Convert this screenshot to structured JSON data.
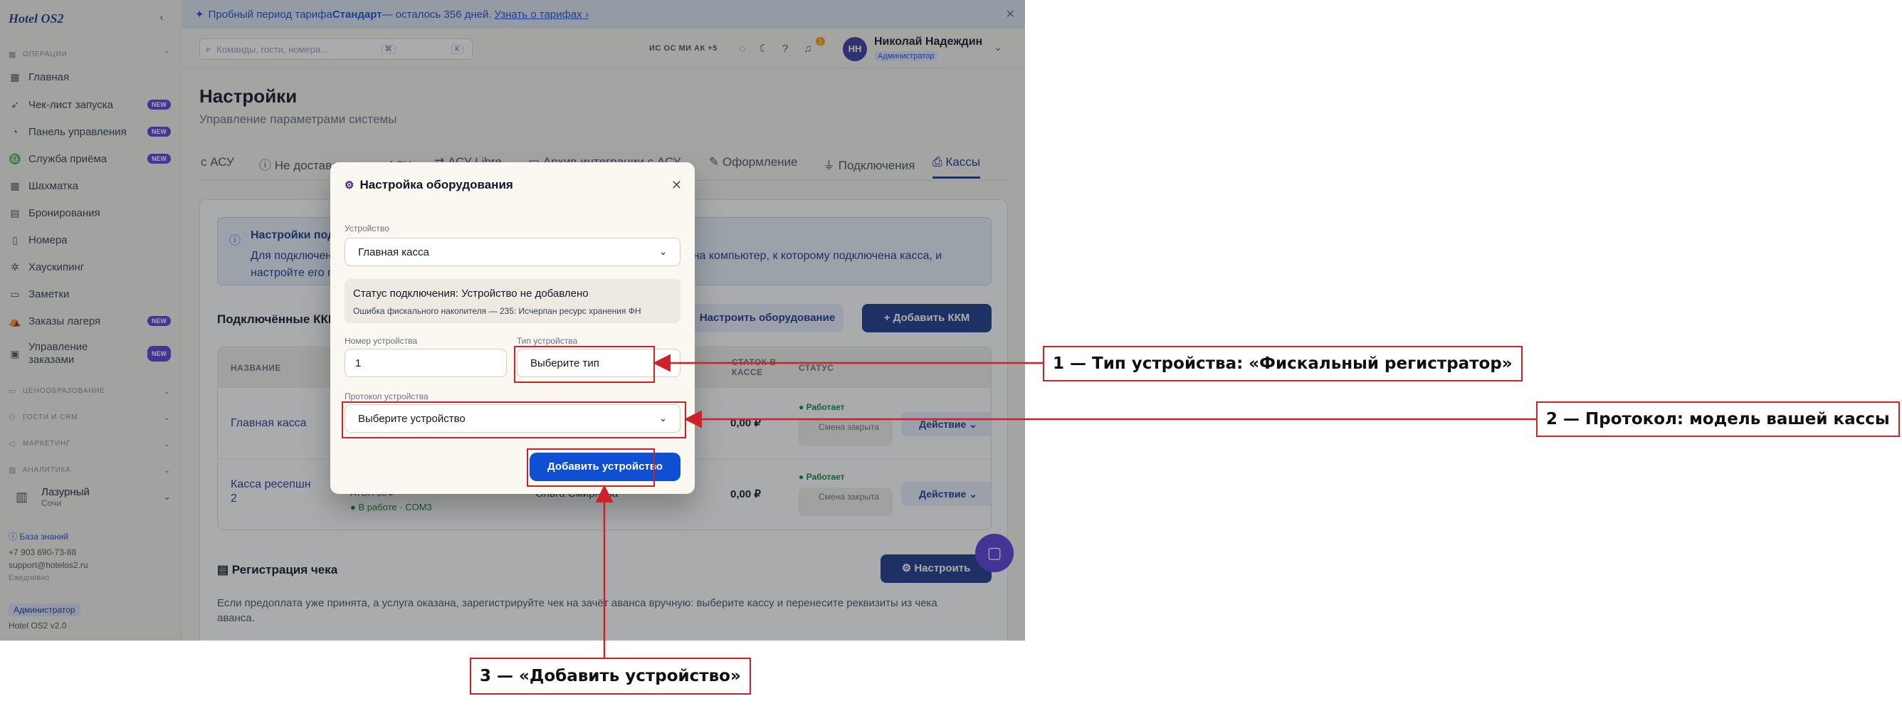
{
  "app": {
    "logo": "Hotel OS2"
  },
  "sidebar": {
    "sections": {
      "operations": "ОПЕРАЦИИ",
      "pricing": "ЦЕНООБРАЗОВАНИЕ",
      "guests": "ГОСТИ И CRM",
      "marketing": "МАРКЕТИНГ",
      "analytics": "АНАЛИТИКА"
    },
    "items": [
      {
        "label": "Главная",
        "badge": ""
      },
      {
        "label": "Чек-лист запуска",
        "badge": "NEW"
      },
      {
        "label": "Панель управления",
        "badge": "NEW"
      },
      {
        "label": "Служба приёма",
        "badge": "NEW"
      },
      {
        "label": "Шахматка",
        "badge": ""
      },
      {
        "label": "Бронирования",
        "badge": ""
      },
      {
        "label": "Номера",
        "badge": ""
      },
      {
        "label": "Хаускипинг",
        "badge": ""
      },
      {
        "label": "Заметки",
        "badge": ""
      },
      {
        "label": "Заказы лагеря",
        "badge": "NEW"
      },
      {
        "label": "Управление заказами",
        "badge": "NEW"
      }
    ],
    "hotel": {
      "name": "Лазурный",
      "city": "Сочи"
    },
    "footer": {
      "kb": "База знаний",
      "phone": "+7 903 690-73-88",
      "email": "support@hotelos2.ru",
      "hours": "Ежедневно",
      "role": "Администратор",
      "version": "Hotel OS2 v2.0"
    }
  },
  "trial_banner": {
    "prefix": "Пробный период тарифа ",
    "plan": "Стандарт",
    "middle": " — осталось 356 дней. ",
    "link": "Узнать о тарифах ›"
  },
  "topbar": {
    "search_placeholder": "Команды, гости, номера...",
    "kbd1": "⌘",
    "kbd2": "K",
    "avatars": "ИС ОС МИ АК +5",
    "notif_count": "1",
    "user_initials": "НН",
    "user_name": "Николай Надеждин",
    "user_role": "Администратор"
  },
  "page": {
    "title": "Настройки",
    "subtitle": "Управление параметрами системы"
  },
  "tabs": [
    "с АСУ",
    "Не доставленные в АСУ",
    "АСУ Libre",
    "Архив интеграции с АСУ",
    "Оформление",
    "Подключения",
    "Кассы"
  ],
  "info": {
    "title": "Настройки подключения кассы",
    "text": "Для подключения кассы выберите тип устройства и протокол. Установите драйвер на компьютер, к которому подключена касса, и настройте его параметры ниже."
  },
  "kkm": {
    "title": "Подключённые ККМ",
    "configure_btn": "Настроить оборудование",
    "add_btn": "+ Добавить ККМ",
    "headers": [
      "НАЗВАНИЕ",
      "СТАТОК В КАССЕ",
      "СТАТУС"
    ],
    "rows": [
      {
        "name": "Главная касса",
        "sum": "0,00 ₽",
        "status": "Работает",
        "shift": "Смена закрыта",
        "action": "Действие ⌄"
      },
      {
        "name": "Касса ресепшн 2",
        "device": "АТОЛ 30Ф",
        "online": "● В работе · COM3",
        "person": "Ольга Смирнова",
        "sum": "0,00 ₽",
        "status": "Работает",
        "shift": "Смена закрыта",
        "action": "Действие ⌄"
      }
    ]
  },
  "receipt": {
    "title": "Регистрация чека",
    "btn": "Настроить",
    "text": "Если предоплата уже принята, а услуга оказана, зарегистрируйте чек на зачёт аванса вручную: выберите кассу и перенесите реквизиты из чека аванса."
  },
  "modal": {
    "title": "Настройка оборудования",
    "device_label": "Устройство",
    "device_value": "Главная касса",
    "status_line": "Статус подключения: Устройство не добавлено",
    "error_line": "Ошибка фискального накопителя — 235: Исчерпан ресурс хранения ФН",
    "number_label": "Номер устройства",
    "number_value": "1",
    "type_label": "Тип устройства",
    "type_value": "Выберите тип",
    "protocol_label": "Протокол устройства",
    "protocol_value": "Выберите устройство",
    "add_button": "Добавить устройство"
  },
  "annotations": [
    "1 — Тип устройства: «Фискальный регистратор»",
    "2 — Протокол: модель вашей кассы",
    "3 — «Добавить устройство»"
  ],
  "colors": {
    "accent": "#1e3a8a",
    "highlight": "#d0202a",
    "badge": "#5b3fd9"
  }
}
